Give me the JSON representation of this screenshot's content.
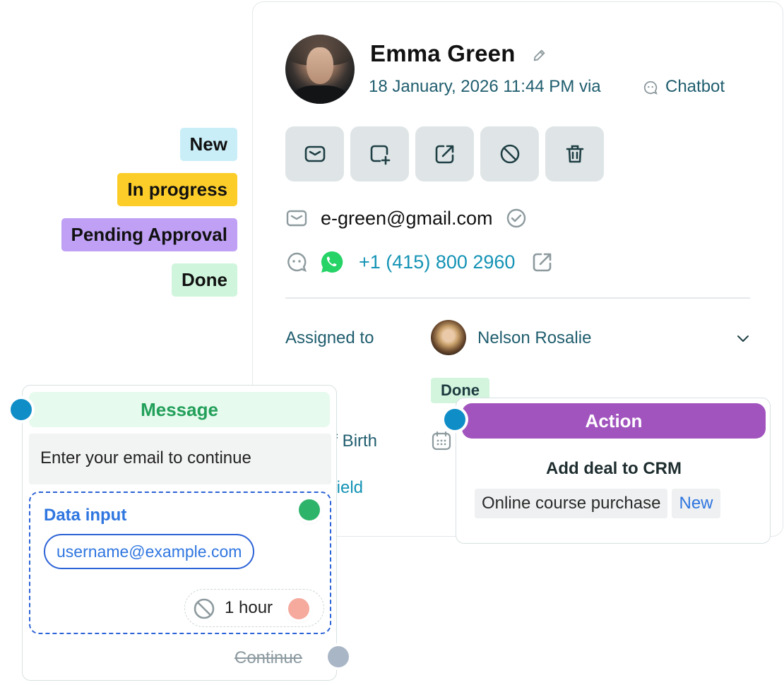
{
  "contact": {
    "name": "Emma Green",
    "datetime": "18 January, 2026 11:44 PM via",
    "channel": "Chatbot",
    "email": "e-green@gmail.com",
    "phone": "+1 (415) 800 2960",
    "assigned_label": "Assigned to",
    "assignee": "Nelson Rosalie",
    "status_chip": "Done",
    "dob_label": "of Birth",
    "field_link": "field"
  },
  "actions": [
    {
      "icon": "mail-icon"
    },
    {
      "icon": "add-note-icon"
    },
    {
      "icon": "external-link-icon"
    },
    {
      "icon": "block-icon"
    },
    {
      "icon": "trash-icon"
    }
  ],
  "tags": [
    {
      "label": "New",
      "color": "#c9eef8"
    },
    {
      "label": "In progress",
      "color": "#fccd28"
    },
    {
      "label": "Pending Approval",
      "color": "#bfa0f5"
    },
    {
      "label": "Done",
      "color": "#cff5dc"
    }
  ],
  "message_node": {
    "title": "Message",
    "text": "Enter your email to continue",
    "data_title": "Data input",
    "data_value": "username@example.com",
    "timeout": "1 hour",
    "continue": "Continue"
  },
  "action_node": {
    "title": "Action",
    "subtitle": "Add deal to CRM",
    "deal": "Online course purchase",
    "status": "New"
  },
  "colors": {
    "accent_teal": "#1f5d6e",
    "link_blue": "#1493b5",
    "message_green": "#22a05a",
    "action_purple": "#a154be",
    "input_blue": "#2c63d6"
  }
}
